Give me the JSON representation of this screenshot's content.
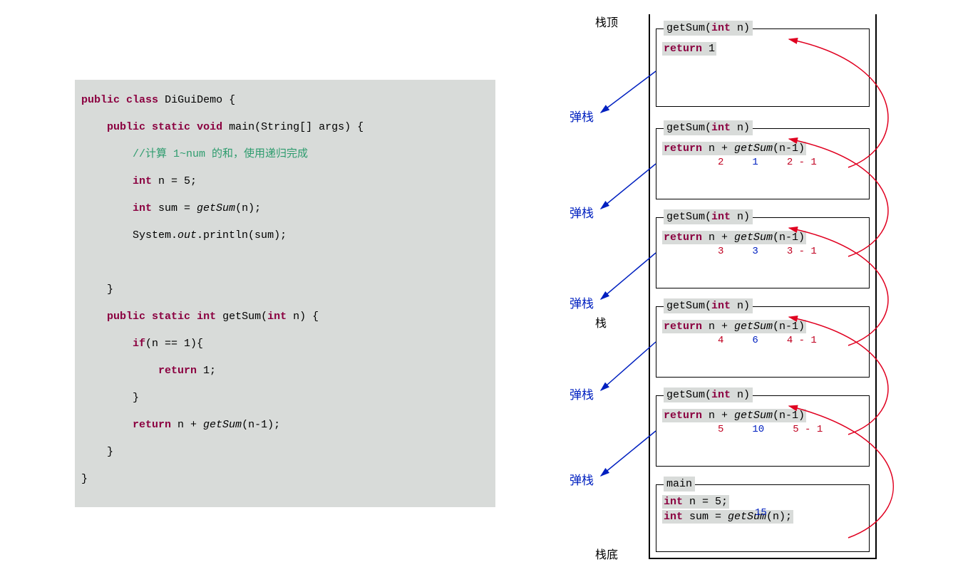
{
  "code": {
    "l1": "public class DiGuiDemo {",
    "l2": "    public static void main(String[] args) {",
    "l3": "        //计算 1~num 的和，使用递归完成",
    "l4": "        int n = 5;",
    "l5": "        int sum = getSum(n);",
    "l6": "        System.out.println(sum);",
    "l7": "",
    "l8": "    }",
    "l9": "    public static int getSum(int n) {",
    "l10": "        if(n == 1){",
    "l11": "            return 1;",
    "l12": "        }",
    "l13": "        return n + getSum(n-1);",
    "l14": "    }",
    "l15": "}"
  },
  "labels": {
    "stack_top": "栈顶",
    "stack_bottom": "栈底",
    "stack": "栈",
    "pop": "弹栈"
  },
  "frames": [
    {
      "title": "getSum(int n)",
      "body": "return 1",
      "vals": {
        "n": "",
        "sum": "",
        "arg": ""
      }
    },
    {
      "title": "getSum(int n)",
      "body": "return n + getSum(n-1)",
      "vals": {
        "n": "2",
        "sum": "1",
        "arg": "2 - 1"
      }
    },
    {
      "title": "getSum(int n)",
      "body": "return n + getSum(n-1)",
      "vals": {
        "n": "3",
        "sum": "3",
        "arg": "3 - 1"
      }
    },
    {
      "title": "getSum(int n)",
      "body": "return n + getSum(n-1)",
      "vals": {
        "n": "4",
        "sum": "6",
        "arg": "4 - 1"
      }
    },
    {
      "title": "getSum(int n)",
      "body": "return n + getSum(n-1)",
      "vals": {
        "n": "5",
        "sum": "10",
        "arg": "5 - 1"
      }
    }
  ],
  "main_frame": {
    "title": "main",
    "line1": "int n = 5;",
    "sum_label": "15",
    "line2": "int sum = getSum(n);"
  }
}
